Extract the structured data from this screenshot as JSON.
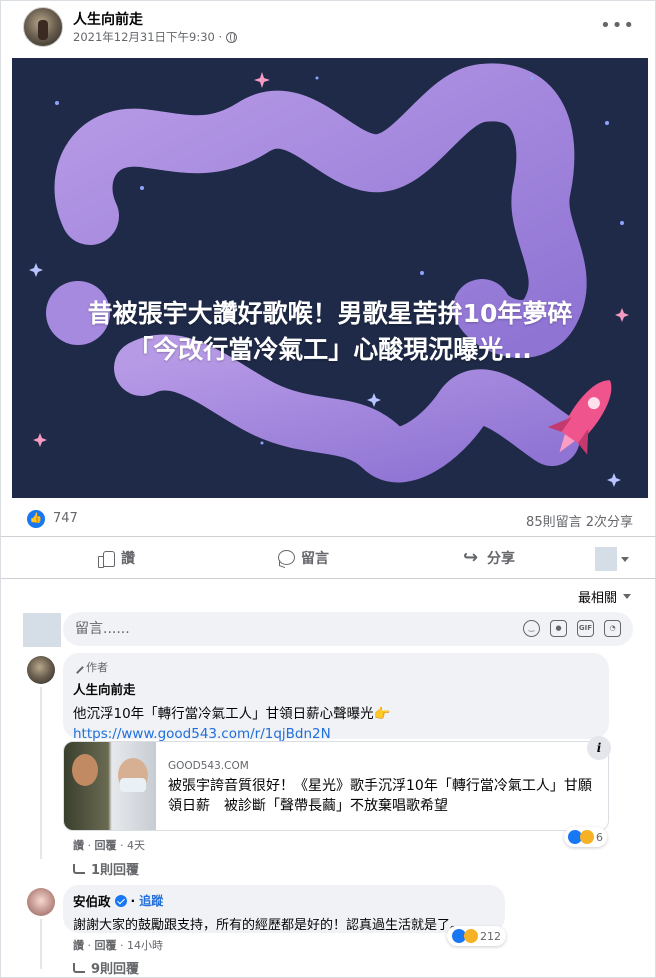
{
  "post": {
    "author": "人生向前走",
    "timestamp": "2021年12月31日下午9:30 ·",
    "privacy_icon": "globe-icon",
    "more_icon": "more-icon"
  },
  "banner": {
    "title_line1": "昔被張宇大讚好歌喉！男歌星苦拚10年夢碎",
    "title_line2": "「今改行當冷氣工」心酸現況曝光...",
    "background_color": "#1f2a48",
    "cloud_color": "#a78bdc",
    "rocket_color": "#f0548c"
  },
  "stats": {
    "like_count": "747",
    "comments_shares": "85則留言  2次分享"
  },
  "actions": {
    "like": "讚",
    "comment": "留言",
    "share": "分享"
  },
  "sort": {
    "label": "最相關"
  },
  "comment_input": {
    "placeholder": "留言......"
  },
  "comments": [
    {
      "author_tag": "作者",
      "name": "人生向前走",
      "text": "他沉浮10年「轉行當冷氣工人」甘領日薪心聲曝光👉",
      "link": "https://www.good543.com/r/1qjBdn2N",
      "card": {
        "domain": "GOOD543.COM",
        "title": "被張宇誇音質很好！《星光》歌手沉浮10年「轉行當冷氣工人」甘願領日薪　被診斷「聲帶長繭」不放棄唱歌希望"
      },
      "reactions": "6",
      "actions": {
        "like": "讚",
        "reply": "回覆",
        "time": "4天"
      },
      "replies_toggle": "1則回覆"
    },
    {
      "name": "安伯政",
      "follow": "追蹤",
      "text": "謝謝大家的鼓勵跟支持，所有的經歷都是好的！認真過生活就是了。",
      "reactions": "212",
      "actions": {
        "like": "讚",
        "reply": "回覆",
        "time": "14小時"
      },
      "replies_toggle": "9則回覆"
    }
  ]
}
